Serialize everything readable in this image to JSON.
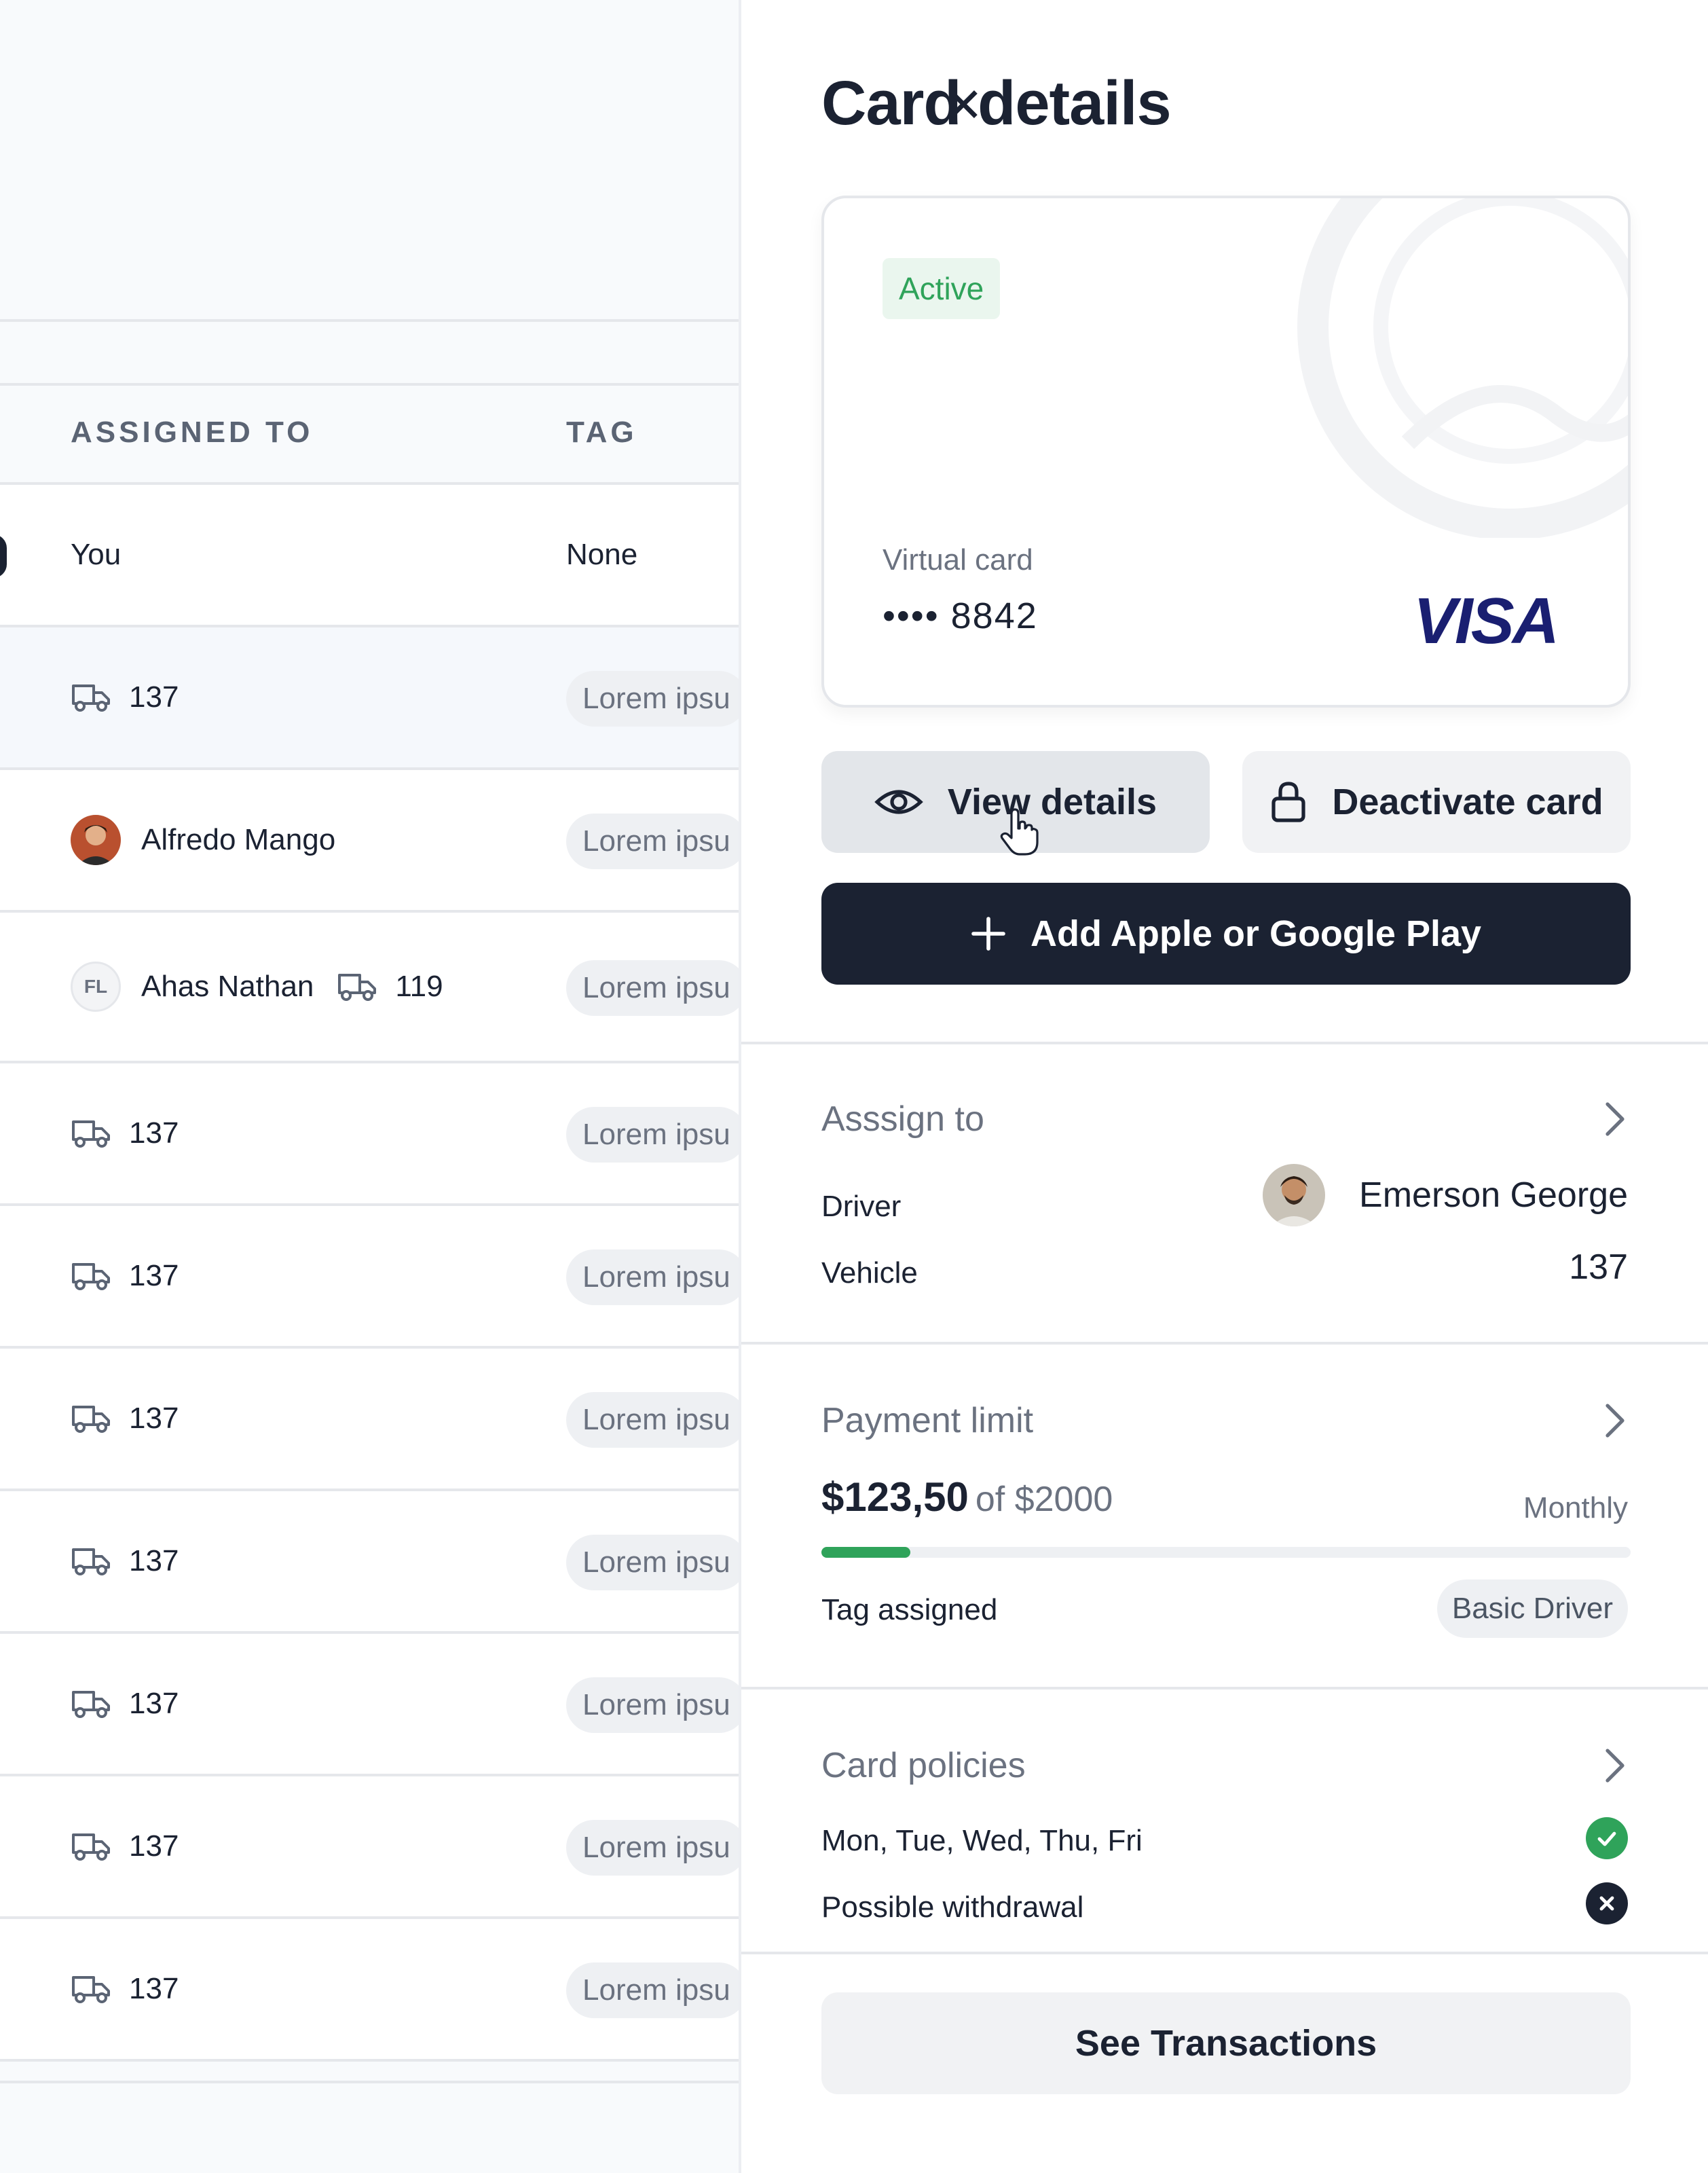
{
  "table": {
    "columns": {
      "assigned_to": "ASSIGNED TO",
      "tag": "TAG"
    },
    "rows": [
      {
        "assigned": "You",
        "tag": "None",
        "kind": "text"
      },
      {
        "assigned": "137",
        "tag": "Lorem ipsu",
        "kind": "vehicle"
      },
      {
        "assigned": "Alfredo Mango",
        "tag": "Lorem ipsu",
        "kind": "person"
      },
      {
        "assigned": "Ahas Nathan",
        "initials": "FL",
        "vehicle": "119",
        "tag": "Lorem ipsu",
        "kind": "person-vehicle"
      },
      {
        "assigned": "137",
        "tag": "Lorem ipsu",
        "kind": "vehicle"
      },
      {
        "assigned": "137",
        "tag": "Lorem ipsu",
        "kind": "vehicle"
      },
      {
        "assigned": "137",
        "tag": "Lorem ipsu",
        "kind": "vehicle"
      },
      {
        "assigned": "137",
        "tag": "Lorem ipsu",
        "kind": "vehicle"
      },
      {
        "assigned": "137",
        "tag": "Lorem ipsu",
        "kind": "vehicle"
      },
      {
        "assigned": "137",
        "tag": "Lorem ipsu",
        "kind": "vehicle"
      },
      {
        "assigned": "137",
        "tag": "Lorem ipsu",
        "kind": "vehicle"
      }
    ]
  },
  "drawer": {
    "title": "Card details",
    "card": {
      "status": "Active",
      "type": "Virtual card",
      "number": "•••• 8842",
      "brand": "VISA"
    },
    "buttons": {
      "view_details": "View details",
      "deactivate": "Deactivate card",
      "add_wallet": "Add Apple or Google Play",
      "see_transactions": "See Transactions"
    },
    "assign": {
      "title": "Asssign to",
      "driver_label": "Driver",
      "driver_value": "Emerson George",
      "vehicle_label": "Vehicle",
      "vehicle_value": "137"
    },
    "payment": {
      "title": "Payment limit",
      "spent": "$123,50",
      "of_limit": "of $2000",
      "period": "Monthly",
      "progress": 0.11,
      "tag_label": "Tag assigned",
      "tag_value": "Basic Driver"
    },
    "policies": {
      "title": "Card policies",
      "items": [
        {
          "label": "Mon, Tue, Wed, Thu, Fri",
          "allowed": true
        },
        {
          "label": "Possible withdrawal",
          "allowed": false
        }
      ]
    }
  },
  "colors": {
    "primary_dark": "#1b2232",
    "success": "#2fa35a",
    "visa_blue": "#1a1f71",
    "muted_text": "#6b7280"
  },
  "icons": {
    "truck": "truck-icon",
    "eye": "eye-icon",
    "lock": "lock-icon",
    "plus": "plus-icon",
    "chevron": "chevron-right-icon",
    "check": "check-circle-icon",
    "x": "x-circle-icon",
    "close": "close-icon",
    "cursor": "hand-cursor-icon"
  }
}
